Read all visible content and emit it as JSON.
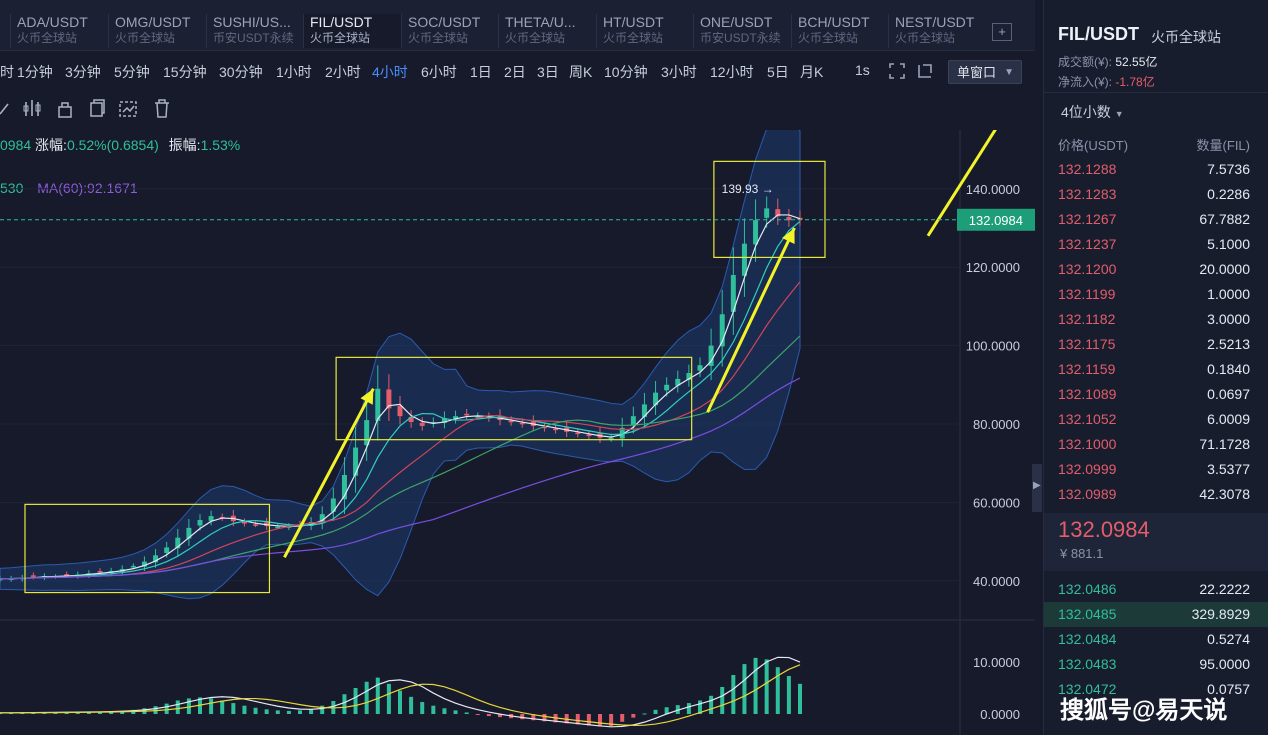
{
  "tabs": [
    {
      "symbol": "ADA/USDT",
      "sub": "火币全球站"
    },
    {
      "symbol": "OMG/USDT",
      "sub": "火币全球站"
    },
    {
      "symbol": "SUSHI/US...",
      "sub": "币安USDT永续"
    },
    {
      "symbol": "FIL/USDT",
      "sub": "火币全球站",
      "active": true
    },
    {
      "symbol": "SOC/USDT",
      "sub": "火币全球站"
    },
    {
      "symbol": "THETA/U...",
      "sub": "火币全球站"
    },
    {
      "symbol": "HT/USDT",
      "sub": "火币全球站"
    },
    {
      "symbol": "ONE/USDT",
      "sub": "币安USDT永续"
    },
    {
      "symbol": "BCH/USDT",
      "sub": "火币全球站"
    },
    {
      "symbol": "NEST/USDT",
      "sub": "火币全球站"
    }
  ],
  "tab_add_label": "+",
  "intervals": [
    "时",
    "1分钟",
    "3分钟",
    "5分钟",
    "15分钟",
    "30分钟",
    "1小时",
    "2小时",
    "4小时",
    "6小时",
    "1日",
    "2日",
    "3日",
    "周K",
    "10分钟",
    "3小时",
    "12小时",
    "5日",
    "月K"
  ],
  "active_interval": "4小时",
  "toolbar": {
    "one_sec": "1s",
    "window_label": "单窗口"
  },
  "info": {
    "price_fragment": "0984",
    "change_label": "涨幅:",
    "change_value": "0.52%(0.6854)",
    "amplitude_label": "振幅:",
    "amplitude_value": "1.53%",
    "ma_fragment": "530",
    "ma60": "MA(60):92.1671"
  },
  "chart_data": {
    "type": "candlestick",
    "price_axis_ticks": [
      "140.0000",
      "120.0000",
      "100.0000",
      "80.0000",
      "60.0000",
      "40.0000"
    ],
    "price_axis_range": [
      30,
      155
    ],
    "current_price_label": "132.0984",
    "high_label": "139.93",
    "macd_axis_ticks": [
      "10.0000",
      "0.0000"
    ],
    "close": [
      40.5,
      40.6,
      40.8,
      41.0,
      41.2,
      41.1,
      41.4,
      41.6,
      41.9,
      42.2,
      42.5,
      43.0,
      43.8,
      44.9,
      46.5,
      48.5,
      51.0,
      53.5,
      55.5,
      56.5,
      56.0,
      55.2,
      54.6,
      54.3,
      54.0,
      53.8,
      53.9,
      54.2,
      55.0,
      57.0,
      61.0,
      67.0,
      74.0,
      81.0,
      89.0,
      84.0,
      82.0,
      80.5,
      79.5,
      80.5,
      81.5,
      82.0,
      82.2,
      82.0,
      81.5,
      81.0,
      80.5,
      80.0,
      79.5,
      79.0,
      78.5,
      78.0,
      77.5,
      77.0,
      76.5,
      76.5,
      79.0,
      82.0,
      85.0,
      88.0,
      90.0,
      91.5,
      93.0,
      95.0,
      100.0,
      108.0,
      118.0,
      126.0,
      132.0,
      135.0,
      133.0,
      132.0,
      132.0985
    ],
    "macd_hist": [
      0.2,
      0.2,
      0.25,
      0.3,
      0.3,
      0.3,
      0.35,
      0.35,
      0.4,
      0.45,
      0.5,
      0.6,
      0.8,
      1.1,
      1.5,
      2.0,
      2.6,
      3.0,
      3.2,
      3.0,
      2.6,
      2.1,
      1.6,
      1.2,
      0.9,
      0.7,
      0.6,
      0.7,
      1.0,
      1.6,
      2.5,
      3.8,
      5.0,
      6.2,
      7.0,
      5.8,
      4.5,
      3.3,
      2.3,
      1.6,
      1.1,
      0.7,
      0.3,
      -0.1,
      -0.4,
      -0.6,
      -0.8,
      -1.0,
      -1.2,
      -1.4,
      -1.6,
      -1.8,
      -2.0,
      -2.2,
      -2.4,
      -2.3,
      -1.5,
      -0.7,
      0.1,
      0.8,
      1.3,
      1.7,
      2.1,
      2.6,
      3.5,
      5.2,
      7.5,
      9.6,
      10.8,
      10.5,
      9.0,
      7.3,
      5.8
    ],
    "ma_series": [
      "MA fast (white)",
      "MA (teal)",
      "MA (red)",
      "MA (green)",
      "MA(60) (purple)"
    ],
    "colors": {
      "up": "#2fbf9a",
      "down": "#e35d6a",
      "bg": "#161a2a",
      "boll_fill": "#1d3a6b",
      "highlight": "#e9e93a",
      "arrow": "#f3f32a",
      "purple": "#7a4ee0"
    }
  },
  "right_panel": {
    "symbol": "FIL/USDT",
    "exchange": "火币全球站",
    "turnover_label": "成交额(¥):",
    "turnover_value": "52.55亿",
    "netflow_label": "净流入(¥):",
    "netflow_value": "-1.78亿",
    "decimals": "4位小数",
    "price_col": "价格(USDT)",
    "qty_col": "数量(FIL)",
    "asks": [
      {
        "p": "132.1288",
        "q": "7.5736"
      },
      {
        "p": "132.1283",
        "q": "0.2286"
      },
      {
        "p": "132.1267",
        "q": "67.7882"
      },
      {
        "p": "132.1237",
        "q": "5.1000"
      },
      {
        "p": "132.1200",
        "q": "20.0000"
      },
      {
        "p": "132.1199",
        "q": "1.0000"
      },
      {
        "p": "132.1182",
        "q": "3.0000"
      },
      {
        "p": "132.1175",
        "q": "2.5213"
      },
      {
        "p": "132.1159",
        "q": "0.1840"
      },
      {
        "p": "132.1089",
        "q": "0.0697"
      },
      {
        "p": "132.1052",
        "q": "6.0009"
      },
      {
        "p": "132.1000",
        "q": "71.1728"
      },
      {
        "p": "132.0999",
        "q": "3.5377"
      },
      {
        "p": "132.0989",
        "q": "42.3078"
      }
    ],
    "last_price": "132.0984",
    "last_cny": "¥ 881.1",
    "bids": [
      {
        "p": "132.0486",
        "q": "22.2222"
      },
      {
        "p": "132.0485",
        "q": "329.8929"
      },
      {
        "p": "132.0484",
        "q": "0.5274"
      },
      {
        "p": "132.0483",
        "q": "95.0000"
      },
      {
        "p": "132.0472",
        "q": "0.0757"
      }
    ]
  },
  "watermark": "搜狐号@易天说"
}
